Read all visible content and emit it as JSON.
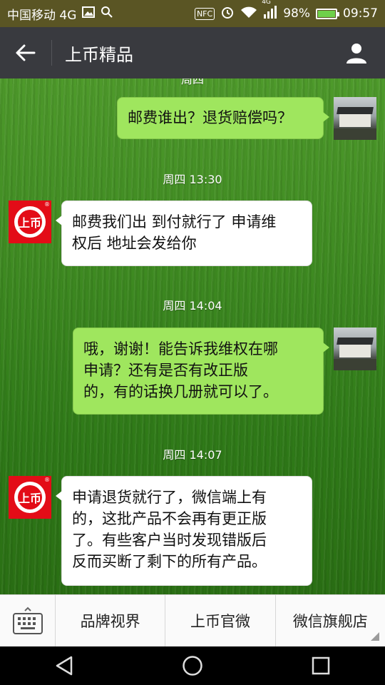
{
  "status_bar": {
    "carrier": "中国移动 4G",
    "nfc": "NFC",
    "signal_label": "4G",
    "battery": "98%",
    "time": "09:57"
  },
  "header": {
    "title": "上币精品"
  },
  "chat": {
    "partial_time": "周四",
    "messages": [
      {
        "side": "right",
        "text": "邮费谁出？退货赔偿吗？"
      },
      {
        "time": "周四 13:30"
      },
      {
        "side": "left",
        "text": "邮费我们出 到付就行了 申请维\n权后 地址会发给你"
      },
      {
        "time": "周四 14:04"
      },
      {
        "side": "right",
        "text": "哦，谢谢！能告诉我维权在哪\n申请？还有是否有改正版\n的，有的话换几册就可以了。"
      },
      {
        "time": "周四 14:07"
      },
      {
        "side": "left",
        "text": "申请退货就行了，微信端上有\n的，这批产品不会再有更正版\n了。有些客户当时发现错版后\n反而买断了剩下的所有产品。"
      }
    ],
    "logo_text": "上币"
  },
  "menu": {
    "items": [
      "品牌视界",
      "上币官微",
      "微信旗舰店"
    ]
  }
}
